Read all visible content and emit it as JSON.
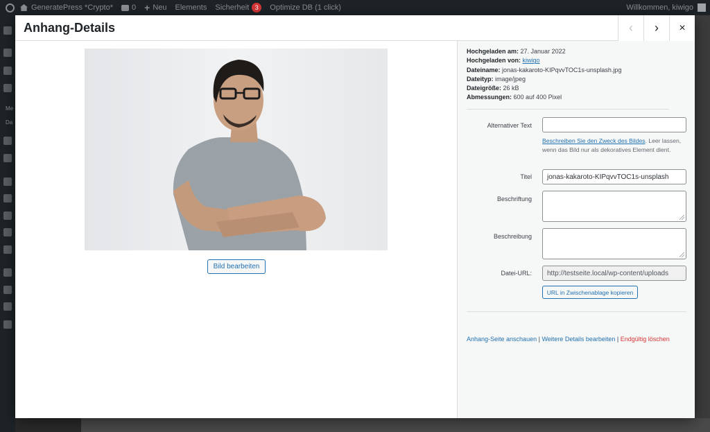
{
  "adminbar": {
    "site_name": "GeneratePress *Crypto*",
    "comments_count": "0",
    "new_label": "Neu",
    "elements_label": "Elements",
    "security_label": "Sicherheit",
    "security_badge": "3",
    "optimize_label": "Optimize DB (1 click)",
    "welcome": "Willkommen, kiwigo"
  },
  "sidebar": {
    "text_1": "Me",
    "text_2": "Da"
  },
  "modal": {
    "title": "Anhang-Details",
    "prev_icon": "‹",
    "next_icon": "›",
    "close_icon": "×"
  },
  "image": {
    "edit_button": "Bild bearbeiten"
  },
  "details": {
    "uploaded_on_label": "Hochgeladen am:",
    "uploaded_on": "27. Januar 2022",
    "uploaded_by_label": "Hochgeladen von:",
    "uploaded_by": "kiwigo",
    "filename_label": "Dateiname:",
    "filename": "jonas-kakaroto-KIPqvvTOC1s-unsplash.jpg",
    "filetype_label": "Dateityp:",
    "filetype": "image/jpeg",
    "filesize_label": "Dateigröße:",
    "filesize": "26 kB",
    "dimensions_label": "Abmessungen:",
    "dimensions": "600 auf 400 Pixel"
  },
  "form": {
    "alt_label": "Alternativer Text",
    "alt_value": "",
    "alt_help_link": "Beschreiben Sie den Zweck des Bildes",
    "alt_help_text": ". Leer lassen, wenn das Bild nur als dekoratives Element dient.",
    "title_label": "Titel",
    "title_value": "jonas-kakaroto-KIPqvvTOC1s-unsplash",
    "caption_label": "Beschriftung",
    "caption_value": "",
    "description_label": "Beschreibung",
    "description_value": "",
    "url_label": "Datei-URL:",
    "url_value": "http://testseite.local/wp-content/uploads",
    "copy_button": "URL in Zwischenablage kopieren"
  },
  "actions": {
    "view": "Anhang-Seite anschauen",
    "separator": "|",
    "edit_more": "Weitere Details bearbeiten",
    "delete": "Endgültig löschen"
  },
  "colors": {
    "link": "#2271b1",
    "delete": "#d63638",
    "adminbar": "#1d2327"
  }
}
